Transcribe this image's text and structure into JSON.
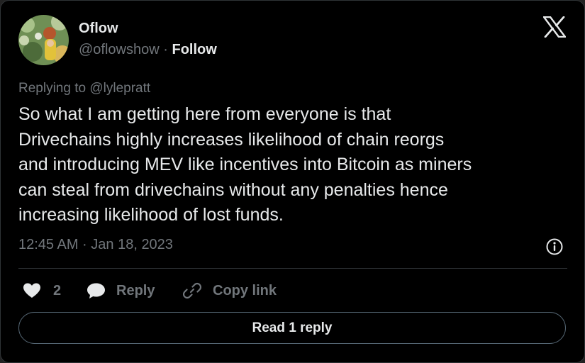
{
  "author": {
    "name": "Oflow",
    "handle": "@oflowshow",
    "separator": "·",
    "follow_label": "Follow"
  },
  "tweet": {
    "replying_to": "Replying to @lylepratt",
    "text_lines": [
      "So what I am getting here from everyone is that",
      "Drivechains highly increases likelihood of chain reorgs",
      "and introducing MEV like incentives into Bitcoin as miners",
      "can steal from drivechains without any penalties hence",
      "increasing likelihood of lost funds."
    ],
    "timestamp": "12:45 AM · Jan 18, 2023"
  },
  "actions": {
    "like_count": "2",
    "reply_label": "Reply",
    "copy_link_label": "Copy link"
  },
  "read_replies_label": "Read 1 reply",
  "icons": {
    "brand": "x-logo-icon",
    "info": "info-icon",
    "like": "heart-icon",
    "reply": "speech-bubble-icon",
    "copy": "link-icon"
  },
  "colors": {
    "background": "#000000",
    "text": "#e7e9ea",
    "muted": "#71767b",
    "border": "#2f3336"
  }
}
